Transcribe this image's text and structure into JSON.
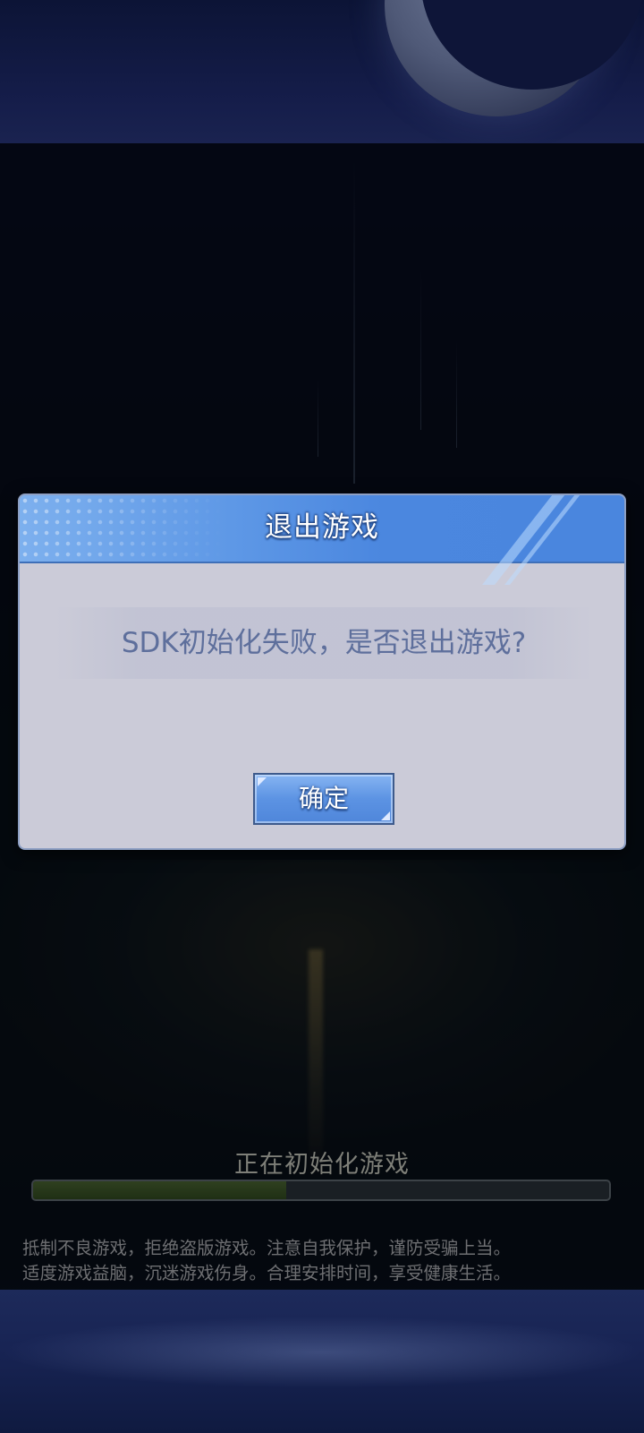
{
  "dialog": {
    "title": "退出游戏",
    "message": "SDK初始化失败，是否退出游戏?",
    "confirm_label": "确定"
  },
  "loading": {
    "status_text": "正在初始化游戏",
    "progress": 0.44
  },
  "notice": {
    "line1": "抵制不良游戏，拒绝盗版游戏。注意自我保护，谨防受骗上当。",
    "line2": "适度游戏益脑，沉迷游戏伤身。合理安排时间，享受健康生活。"
  },
  "icons": {
    "background": "night-sky-city-illustration",
    "moon": "moon-icon"
  },
  "colors": {
    "dialog_header_accent": "#4b87df",
    "dialog_body": "#cbcbd8",
    "message_text": "#5e6f9c",
    "progress_fill": "#2f4020"
  }
}
